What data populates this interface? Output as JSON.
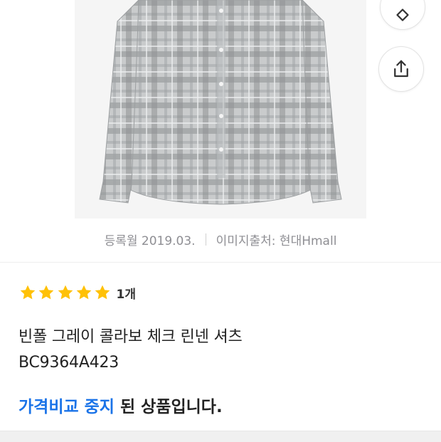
{
  "product": {
    "registered": "등록월 2019.03.",
    "image_source": "이미지출처: 현대Hmall",
    "rating_stars": 5,
    "rating_count": "1개",
    "name_line1": "빈폴 그레이 콜라보 체크 린넨 셔츠",
    "name_line2": "BC9364A423",
    "status_highlight": "가격비교 중지",
    "status_rest": " 된 상품입니다."
  },
  "actions": {
    "tag_icon": "tag-icon",
    "share_icon": "share-icon"
  },
  "colors": {
    "accent": "#1a73e8",
    "star": "#ffc107",
    "meta_text": "#8e8e93"
  }
}
